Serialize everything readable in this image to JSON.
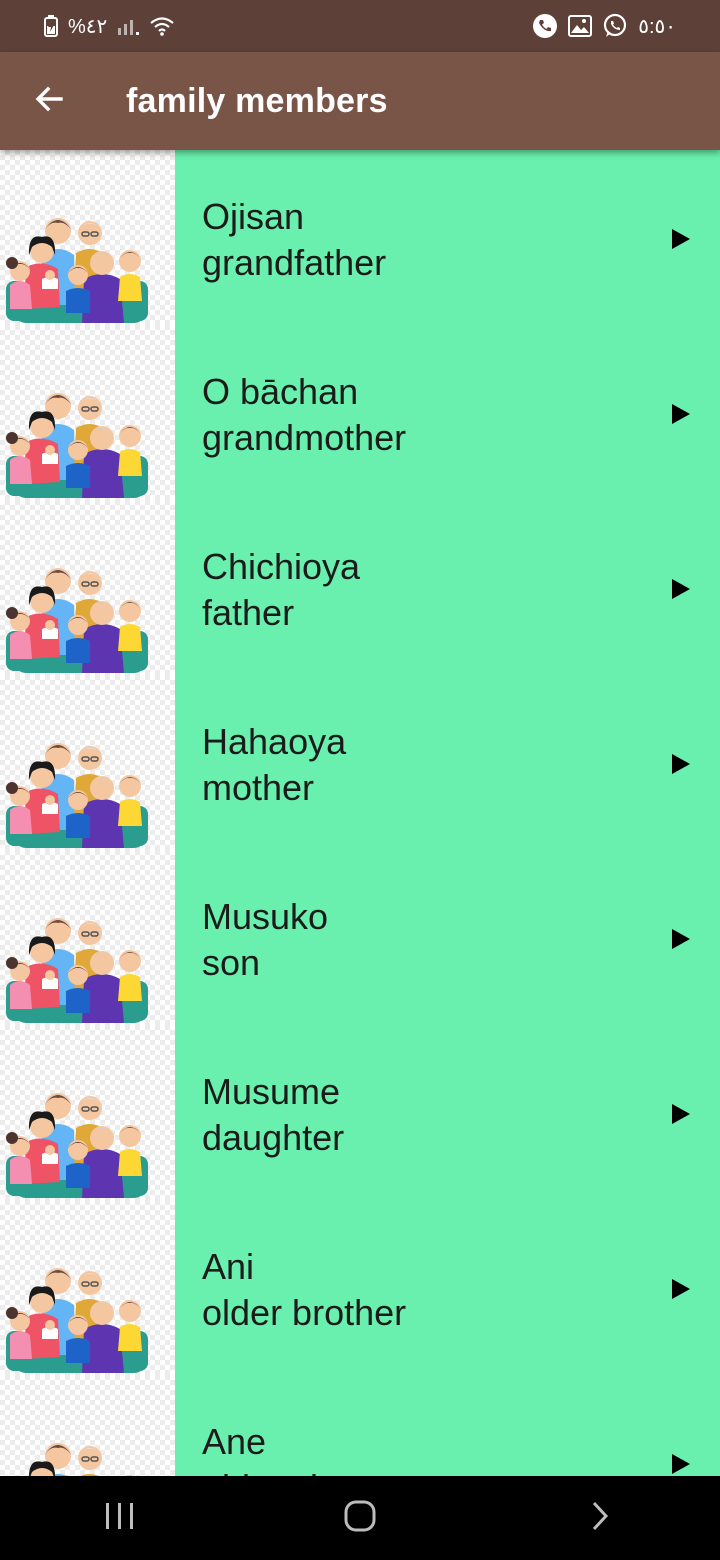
{
  "status_bar": {
    "battery": "%٤٢",
    "time": "٥:٥٠"
  },
  "app_bar": {
    "title": "family members",
    "back_icon": "arrow-back-icon"
  },
  "colors": {
    "status_bar": "#5d4037",
    "app_bar": "#795548",
    "item_background": "#69f0ae",
    "nav_bar": "#000000"
  },
  "items": [
    {
      "japanese": "Ojisan",
      "english": "grandfather"
    },
    {
      "japanese": "O bāchan",
      "english": "grandmother"
    },
    {
      "japanese": "Chichioya",
      "english": "father"
    },
    {
      "japanese": "Hahaoya",
      "english": "mother"
    },
    {
      "japanese": "Musuko",
      "english": "son"
    },
    {
      "japanese": "Musume",
      "english": "daughter"
    },
    {
      "japanese": "Ani",
      "english": "older brother"
    },
    {
      "japanese": "Ane",
      "english": "older sister"
    }
  ],
  "nav_bar": {
    "recents_icon": "recents-icon",
    "home_icon": "home-icon",
    "back_icon": "back-chevron-icon"
  }
}
